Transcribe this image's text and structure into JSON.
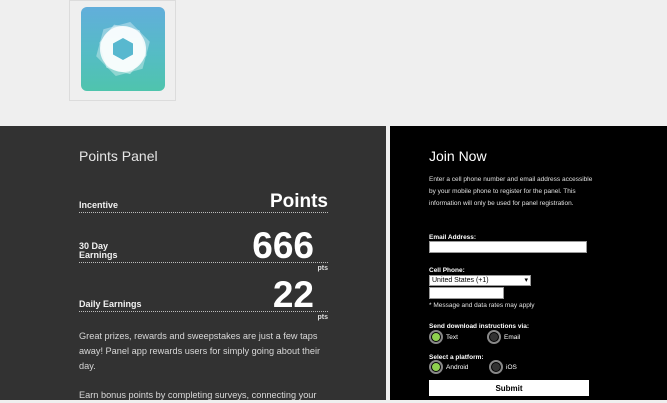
{
  "left": {
    "title": "Points Panel",
    "stats": [
      {
        "label": "Incentive",
        "value": "Points",
        "unit": ""
      },
      {
        "label": "30 Day Earnings",
        "value": "666",
        "unit": "pts"
      },
      {
        "label": "Daily Earnings",
        "value": "22",
        "unit": "pts"
      }
    ],
    "para1": "Great prizes, rewards and sweepstakes are just a few taps away! Panel app rewards users for simply going about their day.",
    "para2": "Earn bonus points by completing surveys, connecting your"
  },
  "join": {
    "title": "Join Now",
    "description": "Enter a cell phone number and email address accessible by your mobile phone to register for the panel. This information will only be used for panel registration.",
    "email_label": "Email Address:",
    "phone_label": "Cell Phone:",
    "country_selected": "United States (+1)",
    "rates_note": "* Message and data rates may apply",
    "send_label": "Send download instructions via:",
    "send_options": [
      "Text",
      "Email"
    ],
    "platform_label": "Select a platform:",
    "platform_options": [
      "Android",
      "iOS"
    ],
    "submit_label": "Submit"
  },
  "colors": {
    "left_bg": "#323232",
    "right_bg": "#000000",
    "radio_on": "#8fd14f"
  }
}
